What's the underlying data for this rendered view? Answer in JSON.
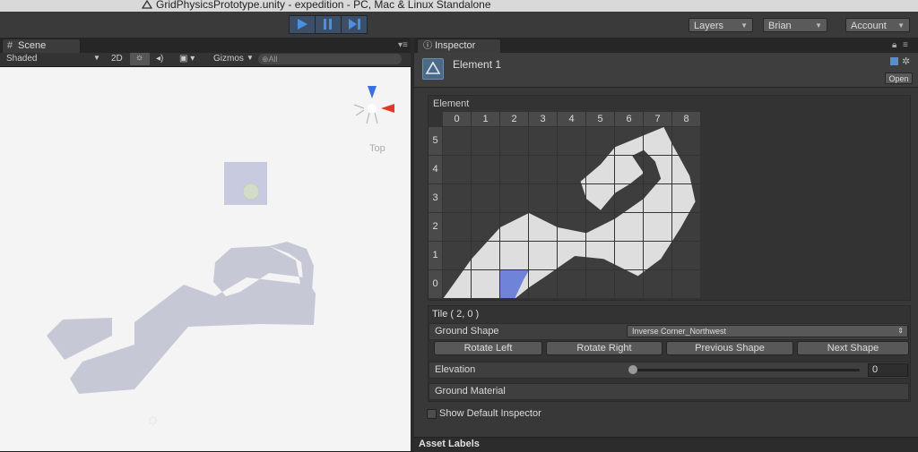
{
  "window": {
    "title": "GridPhysicsPrototype.unity - expedition - PC, Mac & Linux Standalone"
  },
  "toolbar": {
    "play_icon": "play-icon",
    "pause_icon": "pause-icon",
    "step_icon": "step-icon",
    "layers_label": "Layers",
    "layout_label": "Brian",
    "account_label": "Account"
  },
  "scene": {
    "tab_label": "Scene",
    "shading_mode": "Shaded",
    "mode_2d": "2D",
    "gizmos_label": "Gizmos",
    "search_placeholder": "⊕All",
    "orientation_label": "Top"
  },
  "inspector": {
    "tab_label": "Inspector",
    "object_name": "Element 1",
    "open_label": "Open",
    "section_label": "Element",
    "columns": [
      "0",
      "1",
      "2",
      "3",
      "4",
      "5",
      "6",
      "7",
      "8"
    ],
    "rows": [
      "5",
      "4",
      "3",
      "2",
      "1",
      "0"
    ],
    "tile_label": "Tile ( 2, 0 )",
    "ground_shape_label": "Ground Shape",
    "ground_shape_value": "Inverse Corner_Northwest",
    "rotate_left_label": "Rotate Left",
    "rotate_right_label": "Rotate Right",
    "previous_shape_label": "Previous Shape",
    "next_shape_label": "Next Shape",
    "elevation_label": "Elevation",
    "elevation_value": "0",
    "ground_material_label": "Ground Material",
    "show_default_label": "Show Default Inspector",
    "asset_labels": "Asset Labels"
  },
  "colors": {
    "play_active": "#4a8fe0",
    "tile_fill": "#dedede",
    "tile_selected": "#6f84d8",
    "scene_shape": "#c6c8d6",
    "gizmo_x": "#e03a24",
    "gizmo_y": "#3a6fe0"
  }
}
